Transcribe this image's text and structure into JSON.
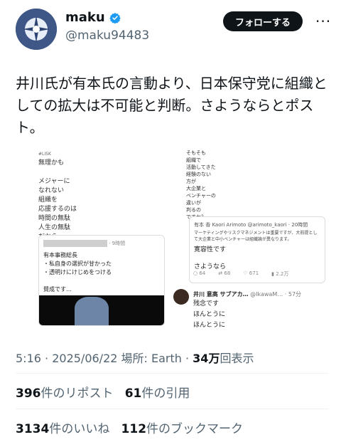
{
  "profile": {
    "name": "maku",
    "handle": "@maku94483",
    "follow_label": "フォローする",
    "more_label": "···"
  },
  "tweet": {
    "text": "井川氏が有本氏の言動より、日本保守党に組織としての拡大は不可能と判断。さようならとポスト。"
  },
  "screenshot": {
    "left_lines": [
      "無理かも",
      "",
      "メジャーに",
      "なれない",
      "組織を",
      "応援するのは",
      "時間の無駄",
      "人生の無駄",
      "だから"
    ],
    "left_card": {
      "time": "· 9時間",
      "lines": [
        "有本事務総長",
        "・私自身の選択が甘かった",
        "・透明けにけじめをつける",
        "",
        "賛成です…"
      ]
    },
    "right_lines": [
      "そもそも",
      "組織で",
      "活動してきた",
      "経験のない",
      "方が",
      "大企業と",
      "ベンチャーの",
      "違いが",
      "判るの",
      "ですか？"
    ],
    "right_card": {
      "author": "有本 香 Kaori Arimoto",
      "author_handle": "@arimoto_kaori · 20時間",
      "snippet": "マーケティングやリスクマネジメントは重要ですが、大前提として大企業と中小ベンチャーは組織論が異なります。",
      "line1": "寛容性です",
      "line2": "さようなら"
    },
    "right_stats": [
      "64",
      "68",
      "671",
      "2.2万"
    ],
    "reply": {
      "author": "井川 意高 サブアカ…",
      "handle": "@IkawaM… · 57分",
      "lines": [
        "残念です",
        "ほんとうに",
        "ほんとうに"
      ]
    }
  },
  "meta": {
    "time": "5:16",
    "date": "2025/06/22",
    "location_label": "場所: Earth",
    "views_value": "34万",
    "views_label": "回表示"
  },
  "counts": {
    "reposts_value": "396",
    "reposts_label": "件のリポスト",
    "quotes_value": "61",
    "quotes_label": "件の引用",
    "likes_value": "3134",
    "likes_label": "件のいいね",
    "bookmarks_value": "112",
    "bookmarks_label": "件のブックマーク"
  },
  "colors": {
    "verified": "#1d9bf0",
    "text": "#0f1419",
    "secondary": "#536471",
    "follow_bg": "#0f1419"
  },
  "icons": [
    "avatar-logo-icon",
    "verified-badge-icon",
    "more-icon"
  ]
}
